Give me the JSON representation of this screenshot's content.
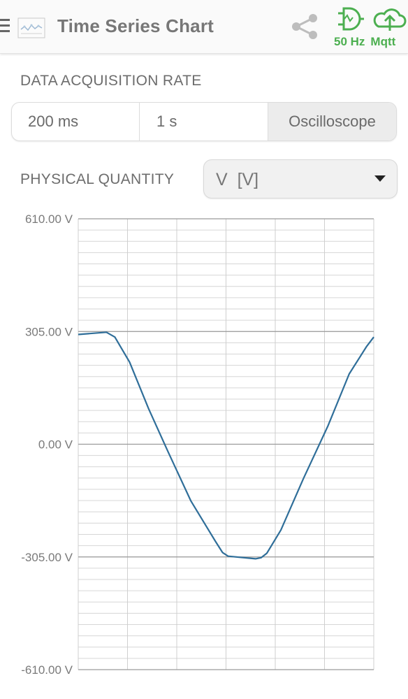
{
  "header": {
    "title": "Time Series Chart",
    "status_rate": "50 Hz",
    "status_protocol": "Mqtt",
    "accent_color": "#4caf50",
    "icons": [
      "menu-icon",
      "chart-logo-icon",
      "share-icon",
      "signal-gate-icon",
      "cloud-upload-icon"
    ]
  },
  "acquisition": {
    "label": "DATA ACQUISITION RATE",
    "options": [
      "200 ms",
      "1 s",
      "Oscilloscope"
    ],
    "selected": "Oscilloscope"
  },
  "quantity": {
    "label": "PHYSICAL QUANTITY",
    "selected": "V  [V]"
  },
  "chart_data": {
    "type": "line",
    "title": "",
    "xlabel": "",
    "ylabel": "",
    "ylim": [
      -610,
      610
    ],
    "y_ticks": [
      610,
      305,
      0,
      -305,
      -610
    ],
    "y_tick_labels": [
      "610.00 V",
      "305.00 V",
      "0.00 V",
      "-305.00 V",
      "-610.00 V"
    ],
    "xlim": [
      0,
      420
    ],
    "grid": true,
    "line_color": "#2f6e99",
    "series": [
      {
        "name": "",
        "x": [
          0,
          40,
          52,
          73,
          100,
          128,
          160,
          195,
          205,
          213,
          252,
          260,
          268,
          288,
          320,
          355,
          385,
          410,
          420
        ],
        "y": [
          297,
          303,
          290,
          222,
          96,
          -22,
          -153,
          -263,
          -293,
          -303,
          -310,
          -307,
          -295,
          -232,
          -93,
          50,
          190,
          265,
          290
        ]
      }
    ]
  }
}
